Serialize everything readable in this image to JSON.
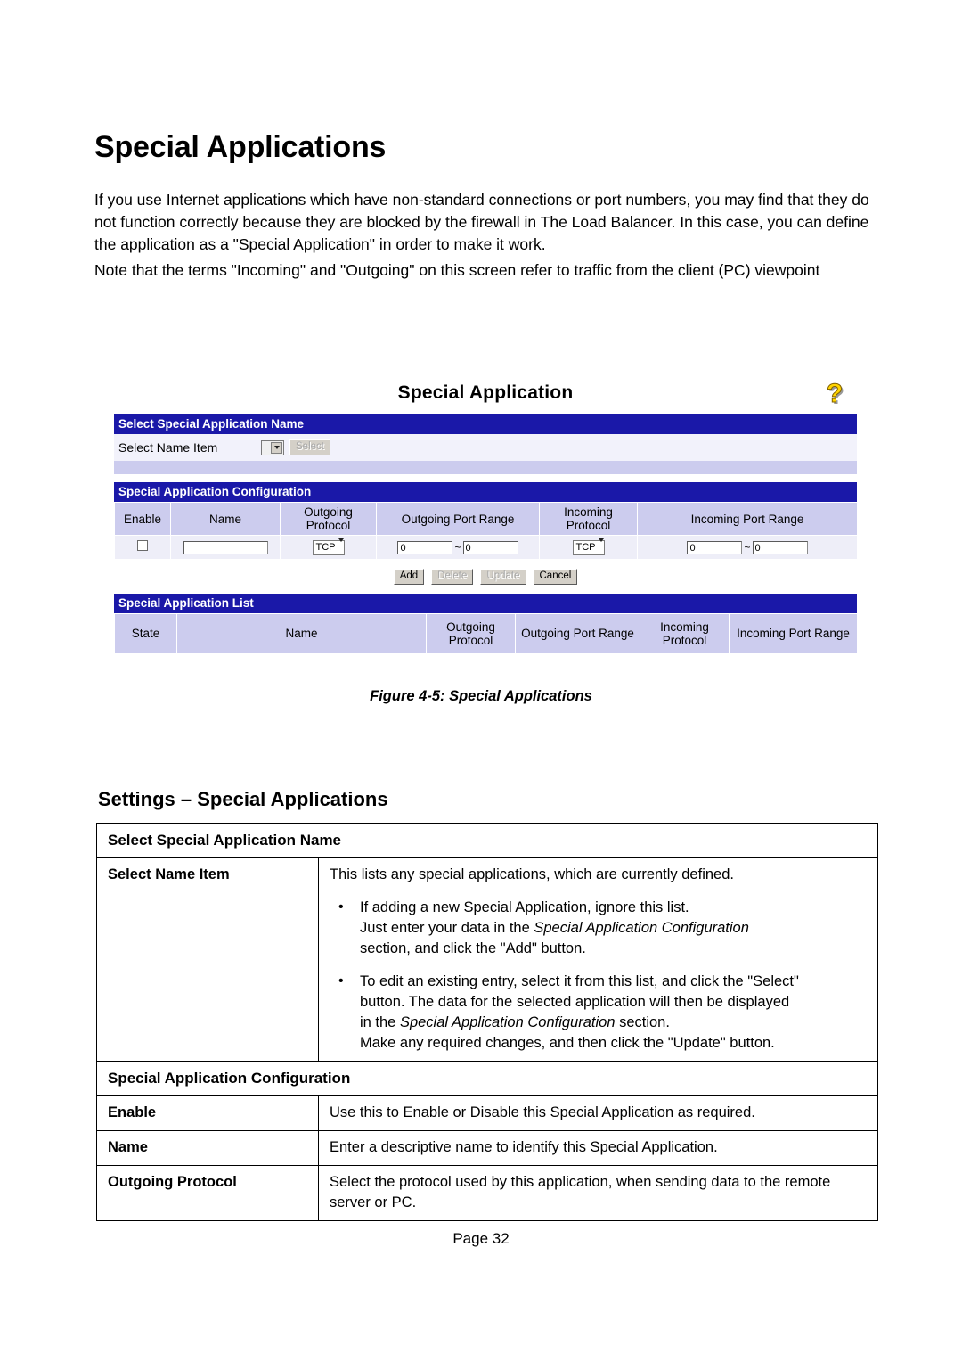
{
  "document": {
    "title": "Special Applications",
    "paragraphs": [
      "If you use Internet applications which have non-standard connections or port numbers, you may find that they do not function correctly because they are blocked by the firewall in The Load Balancer. In this case, you can define the application as a \"Special Application\" in order to make it work.",
      "Note that the terms \"Incoming\" and \"Outgoing\" on this screen refer to traffic from the client (PC) viewpoint"
    ],
    "figure_caption": "Figure 4-5: Special Applications",
    "footer": "Page 32"
  },
  "screenshot": {
    "title": "Special Application",
    "help_icon": "question-mark-help-icon",
    "colors": {
      "header_bar": "#1a18a8",
      "table_header": "#ccccee",
      "table_cell": "#eeeef8",
      "row_background": "#f2f2fb"
    },
    "select_section": {
      "bar": "Select Special Application Name",
      "label": "Select Name Item",
      "dropdown_value": "",
      "select_button": "Select",
      "select_button_disabled": true
    },
    "config_section": {
      "bar": "Special Application Configuration",
      "headers": [
        "Enable",
        "Name",
        "Outgoing Protocol",
        "Outgoing Port Range",
        "Incoming Protocol",
        "Incoming Port Range"
      ],
      "row": {
        "enable_checked": false,
        "name_value": "",
        "outgoing_protocol": "TCP",
        "outgoing_port_start": "0",
        "outgoing_port_end": "0",
        "port_separator": "~",
        "incoming_protocol": "TCP",
        "incoming_port_start": "0",
        "incoming_port_end": "0"
      },
      "buttons": [
        {
          "label": "Add",
          "disabled": false
        },
        {
          "label": "Delete",
          "disabled": true
        },
        {
          "label": "Update",
          "disabled": true
        },
        {
          "label": "Cancel",
          "disabled": false
        }
      ]
    },
    "list_section": {
      "bar": "Special Application List",
      "headers": [
        "State",
        "Name",
        "Outgoing Protocol",
        "Outgoing Port Range",
        "Incoming Protocol",
        "Incoming Port Range"
      ],
      "rows": []
    }
  },
  "settings": {
    "heading": "Settings – Special Applications",
    "sections": [
      {
        "title": "Select Special Application Name",
        "rows": [
          {
            "key": "Select Name Item",
            "intro": "This lists any special applications, which are currently defined.",
            "bullets": [
              {
                "lines": [
                  {
                    "text": "If adding a new Special Application, ignore this list.",
                    "italic_part": ""
                  },
                  {
                    "pre": "Just enter your data in the ",
                    "italic": "Special Application Configuration",
                    "post": ""
                  },
                  {
                    "pre": "section, and click the \"Add\" button.",
                    "italic": "",
                    "post": ""
                  }
                ]
              },
              {
                "lines": [
                  {
                    "text": "To edit an existing entry, select it from this list, and click the \"Select\"",
                    "italic_part": ""
                  },
                  {
                    "pre": "button. The data for the selected application will then be displayed",
                    "italic": "",
                    "post": ""
                  },
                  {
                    "pre": "in the ",
                    "italic": "Special Application Configuration",
                    "post": " section."
                  },
                  {
                    "pre": "Make any required changes, and then click the \"Update\" button.",
                    "italic": "",
                    "post": ""
                  }
                ]
              }
            ]
          }
        ]
      },
      {
        "title": "Special Application Configuration",
        "rows": [
          {
            "key": "Enable",
            "value": "Use this to Enable or Disable this Special Application as required."
          },
          {
            "key": "Name",
            "value": "Enter a descriptive name to identify this Special Application."
          },
          {
            "key": "Outgoing Protocol",
            "value": "Select the protocol used by this application, when sending data to the remote server or PC."
          }
        ]
      }
    ]
  }
}
